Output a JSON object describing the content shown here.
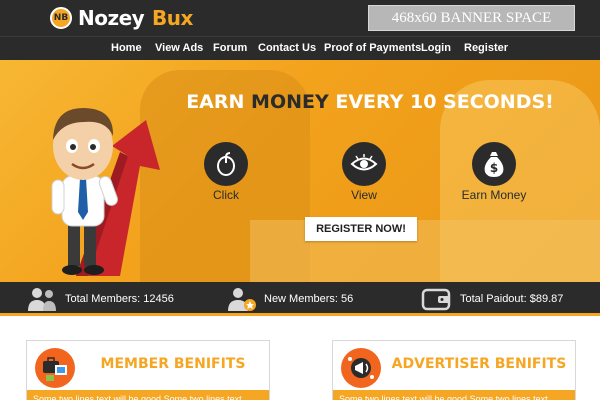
{
  "header": {
    "logo_badge": "NB",
    "logo_name_part1": "Nozey",
    "logo_name_part2": "Bux",
    "banner_text": "468x60 BANNER SPACE"
  },
  "nav": {
    "items": [
      {
        "label": "Home"
      },
      {
        "label": "View Ads"
      },
      {
        "label": "Forum"
      },
      {
        "label": "Contact Us"
      },
      {
        "label": "Proof of Payments"
      },
      {
        "label": "Login"
      },
      {
        "label": "Register"
      }
    ]
  },
  "hero": {
    "headline_start": "EARN ",
    "headline_accent": "MONEY",
    "headline_end": " EVERY 10 SECONDS!",
    "features": [
      {
        "icon": "mouse-icon",
        "label": "Click"
      },
      {
        "icon": "eye-icon",
        "label": "View"
      },
      {
        "icon": "money-bag-icon",
        "label": "Earn Money"
      }
    ],
    "register_label": "REGISTER NOW!"
  },
  "stats": {
    "total_members": "Total Members: 12456",
    "new_members": "New Members: 56",
    "total_paidout": "Total Paidout: $89.87"
  },
  "cards": {
    "member_title": "MEMBER BENIFITS",
    "member_text": "Some two lines text will be good Some two lines text",
    "advertiser_title": "ADVERTISER BENIFITS",
    "advertiser_text": "Some two lines text will be good Some two lines text"
  },
  "colors": {
    "accent": "#f5a623",
    "dark": "#2b2b2b",
    "card_icon": "#f2651f"
  }
}
